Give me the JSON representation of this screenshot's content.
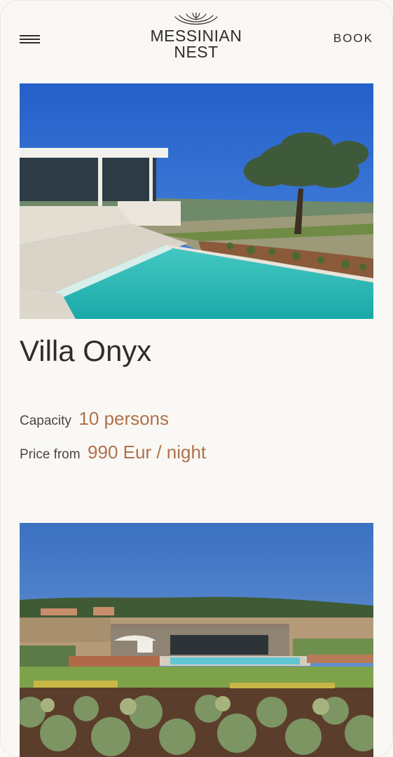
{
  "header": {
    "logo_line1": "MESSINIAN",
    "logo_line2": "NEST",
    "book_label": "BOOK"
  },
  "villas": [
    {
      "name": "Villa Onyx",
      "capacity_label": "Capacity",
      "capacity_value": "10 persons",
      "price_label": "Price from",
      "price_value": "990 Eur / night"
    }
  ],
  "colors": {
    "accent": "#b0714a",
    "text": "#2f2c2a",
    "background": "#faf8f5"
  }
}
